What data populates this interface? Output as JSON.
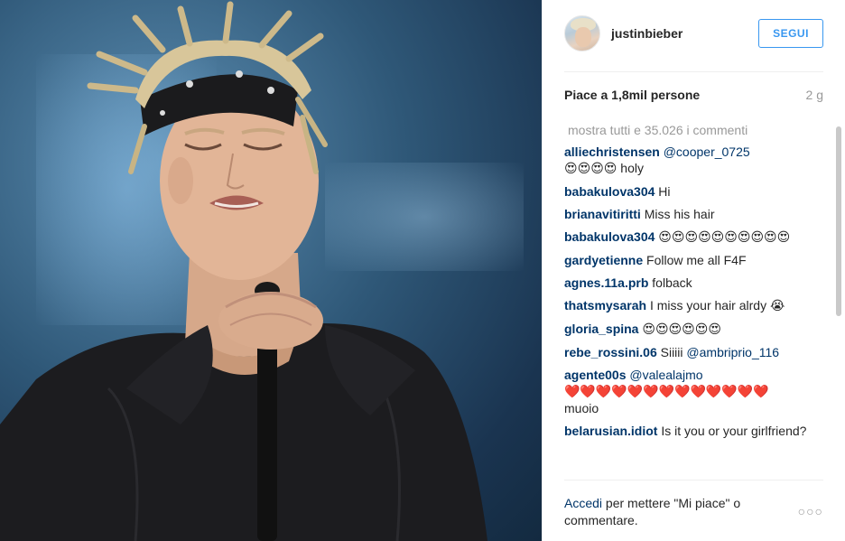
{
  "post": {
    "photo_alt": "Justin Bieber photo"
  },
  "header": {
    "username": "justinbieber",
    "follow_label": "SEGUI"
  },
  "stats": {
    "likes": "Piace a 1,8mil persone",
    "time": "2 g"
  },
  "comments": {
    "show_all": "mostra tutti e 35.026 i commenti",
    "items": [
      {
        "user": "alliechristensen",
        "mention": "@cooper_0725",
        "text": "",
        "emoji": "😍😍😍😍",
        "after": " holy"
      },
      {
        "user": "babakulova304",
        "text": "Hi"
      },
      {
        "user": "brianavitiritti",
        "text": "Miss his hair"
      },
      {
        "user": "babakulova304",
        "emoji": "😍😍😍😍😍😍😍😍😍😍"
      },
      {
        "user": "gardyetienne",
        "text": "Follow me all F4F"
      },
      {
        "user": "agnes.11a.prb",
        "text": "folback"
      },
      {
        "user": "thatsmysarah",
        "text": "I miss your hair alrdy",
        "emoji": "😭"
      },
      {
        "user": "gloria_spina",
        "emoji": "😍😍😍😍😍😍"
      },
      {
        "user": "rebe_rossini.06",
        "text": "Siiiii",
        "mention": "@ambriprio_116"
      },
      {
        "user": "agente00s",
        "mention": "@valealajmo",
        "hearts": "❤️❤️❤️❤️❤️❤️❤️❤️❤️❤️❤️❤️❤️",
        "after": "muoio"
      },
      {
        "user": "belarusian.idiot",
        "text": "Is it you or your girlfriend?"
      }
    ]
  },
  "footer": {
    "login_link": "Accedi",
    "login_text": " per mettere \"Mi piace\" o commentare.",
    "more_icon": "ellipsis-icon",
    "more_glyph": "○○○"
  }
}
